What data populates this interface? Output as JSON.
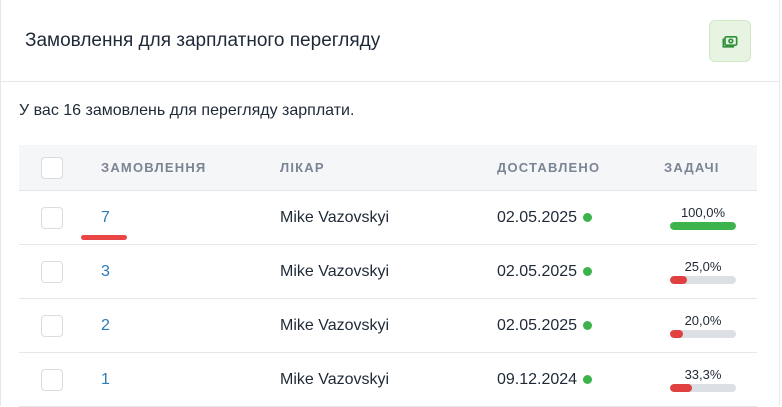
{
  "card": {
    "title": "Замовлення для зарплатного перегляду",
    "subtitle": "У вас 16 замовлень для перегляду зарплати.",
    "icon": "money-icon"
  },
  "table": {
    "headers": {
      "order": "ЗАМОВЛЕННЯ",
      "doctor": "ЛІКАР",
      "delivered": "ДОСТАВЛЕНО",
      "tasks": "ЗАДАЧІ"
    },
    "rows": [
      {
        "order": "7",
        "doctor": "Mike Vazovskyi",
        "delivered": "02.05.2025",
        "tasks_label": "100,0%",
        "tasks_value": 1.0,
        "bar_color": "#3cb44b"
      },
      {
        "order": "3",
        "doctor": "Mike Vazovskyi",
        "delivered": "02.05.2025",
        "tasks_label": "25,0%",
        "tasks_value": 0.25,
        "bar_color": "#e04040"
      },
      {
        "order": "2",
        "doctor": "Mike Vazovskyi",
        "delivered": "02.05.2025",
        "tasks_label": "20,0%",
        "tasks_value": 0.2,
        "bar_color": "#e04040"
      },
      {
        "order": "1",
        "doctor": "Mike Vazovskyi",
        "delivered": "09.12.2024",
        "tasks_label": "33,3%",
        "tasks_value": 0.333,
        "bar_color": "#e04040"
      }
    ]
  },
  "colors": {
    "link": "#2b7bb9",
    "status_dot": "#3cb44b",
    "accent_red": "#e84545"
  }
}
